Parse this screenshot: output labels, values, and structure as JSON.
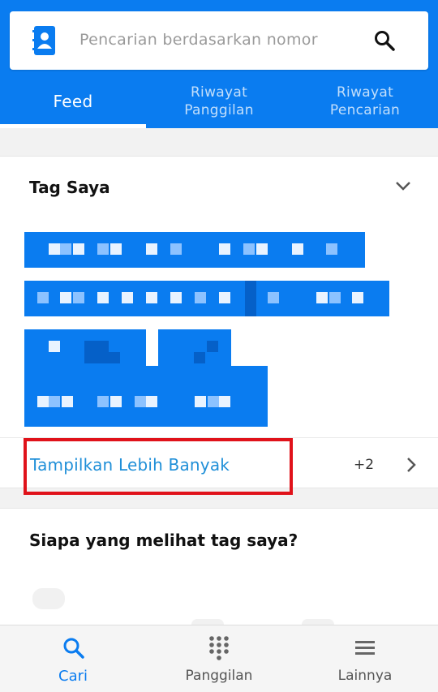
{
  "search": {
    "placeholder": "Pencarian berdasarkan nomor"
  },
  "tabs": [
    {
      "line1": "Feed",
      "line2": ""
    },
    {
      "line1": "Riwayat",
      "line2": "Panggilan"
    },
    {
      "line1": "Riwayat",
      "line2": "Pencarian"
    }
  ],
  "tags_section": {
    "title": "Tag Saya",
    "show_more_label": "Tampilkan Lebih Banyak",
    "more_count": "+2"
  },
  "viewers_section": {
    "title": "Siapa yang melihat tag saya?"
  },
  "bottom_nav": [
    {
      "label": "Cari",
      "icon": "search-icon",
      "active": true
    },
    {
      "label": "Panggilan",
      "icon": "dialpad-icon",
      "active": false
    },
    {
      "label": "Lainnya",
      "icon": "menu-icon",
      "active": false
    }
  ],
  "colors": {
    "primary": "#0a7cf0",
    "highlight_box": "#e0121a",
    "link": "#1f8fd8"
  }
}
